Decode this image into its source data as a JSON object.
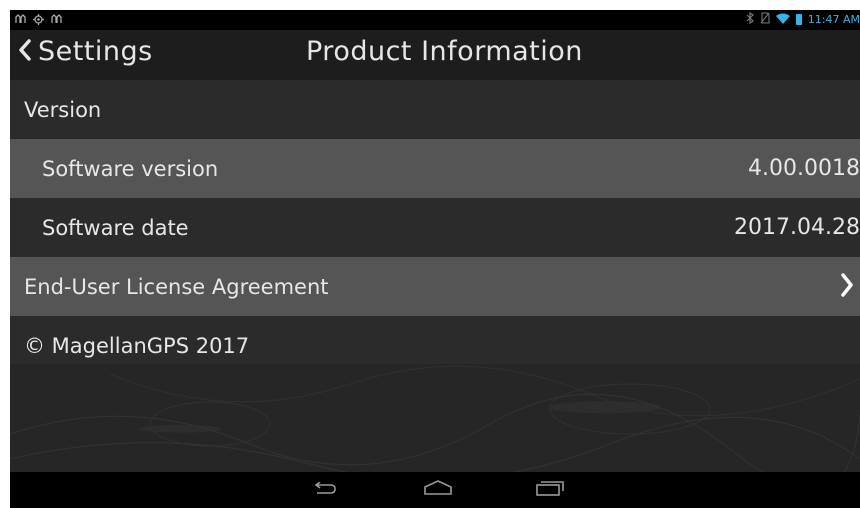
{
  "status_bar": {
    "time": "11:47 AM"
  },
  "header": {
    "back_label": "Settings",
    "title": "Product Information"
  },
  "rows": {
    "version_section": "Version",
    "software_version_label": "Software version",
    "software_version_value": "4.00.0018",
    "software_date_label": "Software date",
    "software_date_value": "2017.04.28",
    "eula_label": "End-User License Agreement",
    "copyright": "© MagellanGPS 2017"
  },
  "colors": {
    "accent": "#33b5e5",
    "header_bg": "#1d1d1d",
    "row_dark": "#2b2b2b",
    "row_light": "#555555"
  }
}
